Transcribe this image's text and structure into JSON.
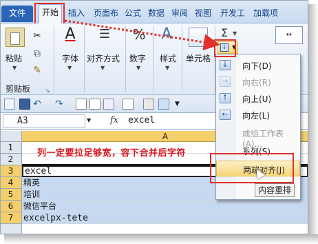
{
  "tabs": [
    "文件",
    "开始",
    "插入",
    "页面布",
    "公式",
    "数据",
    "审阅",
    "视图",
    "开发工",
    "加载项"
  ],
  "ribbon": {
    "paste_label": "粘贴",
    "clipboard_group": "剪贴板",
    "font_label": "字体",
    "align_label": "对齐方式",
    "number_label": "数字",
    "style_label": "样式",
    "cells_label": "单元格",
    "sigma_symbol": "Σ",
    "number_symbol": "%",
    "style_symbol": "A",
    "font_symbol": "A",
    "cut_symbol": "✂"
  },
  "formula_bar": {
    "cell_ref": "A3",
    "fx": "fx",
    "value": "excel"
  },
  "sheet": {
    "column": "A",
    "rows": [
      {
        "num": "1",
        "text": ""
      },
      {
        "num": "2",
        "text": ""
      },
      {
        "num": "3",
        "text": "excel"
      },
      {
        "num": "4",
        "text": "精英"
      },
      {
        "num": "5",
        "text": "培训"
      },
      {
        "num": "6",
        "text": "微信平台"
      },
      {
        "num": "7",
        "text": "excelpx-tete"
      }
    ],
    "annotation": "列一定要拉足够宽，容下合并后字符"
  },
  "fill_menu": {
    "items": [
      {
        "label": "向下(D)",
        "icon": "fill-down-icon",
        "glyph": "↓",
        "enabled": true
      },
      {
        "label": "向右(R)",
        "icon": "fill-right-icon",
        "glyph": "→",
        "enabled": false
      },
      {
        "label": "向上(U)",
        "icon": "fill-up-icon",
        "glyph": "↑",
        "enabled": true
      },
      {
        "label": "向左(L)",
        "icon": "fill-left-icon",
        "glyph": "←",
        "enabled": true
      },
      {
        "label": "成组工作表(A)...",
        "icon": "",
        "glyph": "",
        "enabled": false
      },
      {
        "label": "系列(S)...",
        "icon": "",
        "glyph": "",
        "enabled": true
      },
      {
        "label": "两端对齐(J)",
        "icon": "",
        "glyph": "",
        "enabled": true
      },
      {
        "label": "内容重排",
        "icon": "",
        "glyph": "",
        "enabled": true
      }
    ]
  },
  "colors": {
    "highlight_red": "#e0312c",
    "annotation_red": "#d9151c",
    "header_gold": "#f4cf6c",
    "selection_blue": "#c6d9f0"
  }
}
